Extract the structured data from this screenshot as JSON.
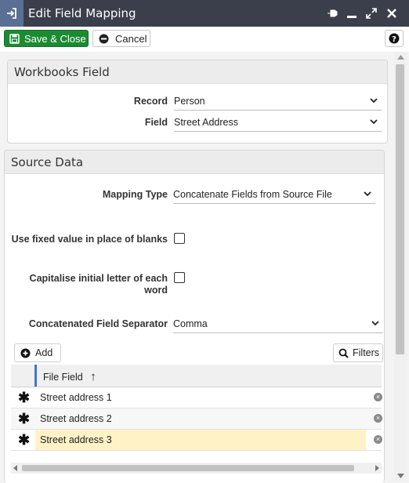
{
  "window": {
    "title": "Edit Field Mapping",
    "title_icon": "sign-in-icon",
    "controls": [
      "pin-icon",
      "minimize-icon",
      "expand-icon",
      "close-icon"
    ]
  },
  "toolbar": {
    "save_label": "Save & Close",
    "cancel_label": "Cancel",
    "help_icon": "help-icon"
  },
  "workbooks_field": {
    "heading": "Workbooks Field",
    "record_label": "Record",
    "record_value": "Person",
    "field_label": "Field",
    "field_value": "Street Address"
  },
  "source_data": {
    "heading": "Source Data",
    "mapping_type_label": "Mapping Type",
    "mapping_type_value": "Concatenate Fields from Source File",
    "fixed_value_label": "Use fixed value in place of blanks",
    "capitalise_label_1": "Capitalise initial letter of each",
    "capitalise_label_2": "word",
    "separator_label": "Concatenated Field Separator",
    "separator_value": "Comma",
    "add_label": "Add",
    "filters_label": "Filters"
  },
  "grid": {
    "column_header": "File Field",
    "sort_indicator": "↑",
    "rows": [
      {
        "marker": "✱",
        "value": "Street address 1"
      },
      {
        "marker": "✱",
        "value": "Street address 2"
      },
      {
        "marker": "✱",
        "value": "Street address 3"
      }
    ]
  },
  "colors": {
    "titlebar": "#3a3f4b",
    "save_button": "#1b8a33",
    "selected_row": "#fff2c6",
    "sort_column_accent": "#3b78c8"
  }
}
